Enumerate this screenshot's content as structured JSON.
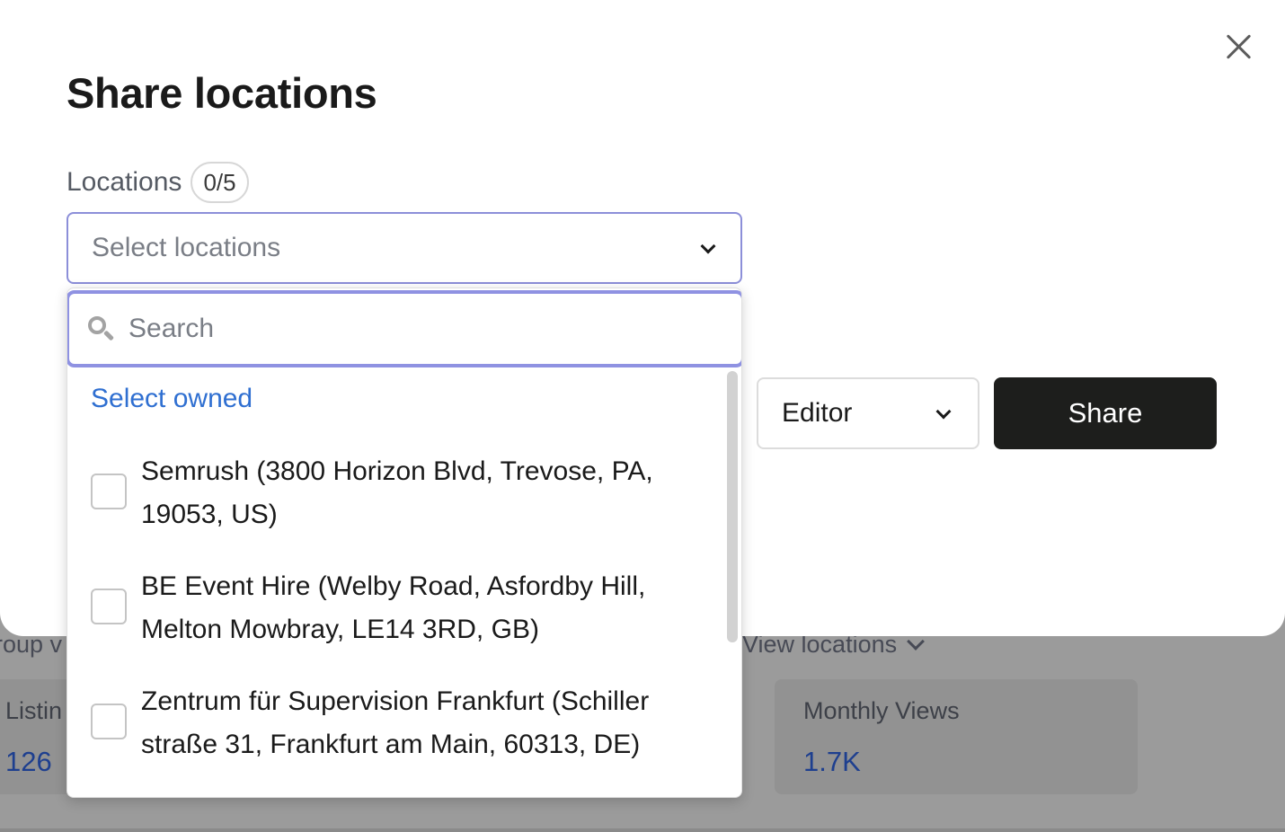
{
  "background": {
    "group_label": "roup v",
    "view_locations_label": "View locations",
    "card_left": {
      "label": "Listin",
      "value": "126"
    },
    "card_right": {
      "label": "Monthly Views",
      "value": "1.7K"
    }
  },
  "modal": {
    "title": "Share locations",
    "locations_label": "Locations",
    "locations_count": "0/5",
    "select_placeholder": "Select locations",
    "role_value": "Editor",
    "share_label": "Share"
  },
  "dropdown": {
    "search_placeholder": "Search",
    "select_owned_label": "Select owned",
    "options": [
      {
        "label": "Semrush (3800 Horizon Blvd, Trevose, PA, 19053, US)",
        "checked": false
      },
      {
        "label": "BE Event Hire (Welby Road, Asfordby Hill, Melton Mowbray, LE14 3RD, GB)",
        "checked": false
      },
      {
        "label": "Zentrum für Supervision Frankfurt (Schiller straße 31, Frankfurt am Main, 60313, DE)",
        "checked": false
      }
    ]
  },
  "colors": {
    "accent_border": "#8f92e2",
    "link": "#2f6fd1",
    "primary_button": "#1d1e1c",
    "metric_value": "#1e3f8f"
  }
}
